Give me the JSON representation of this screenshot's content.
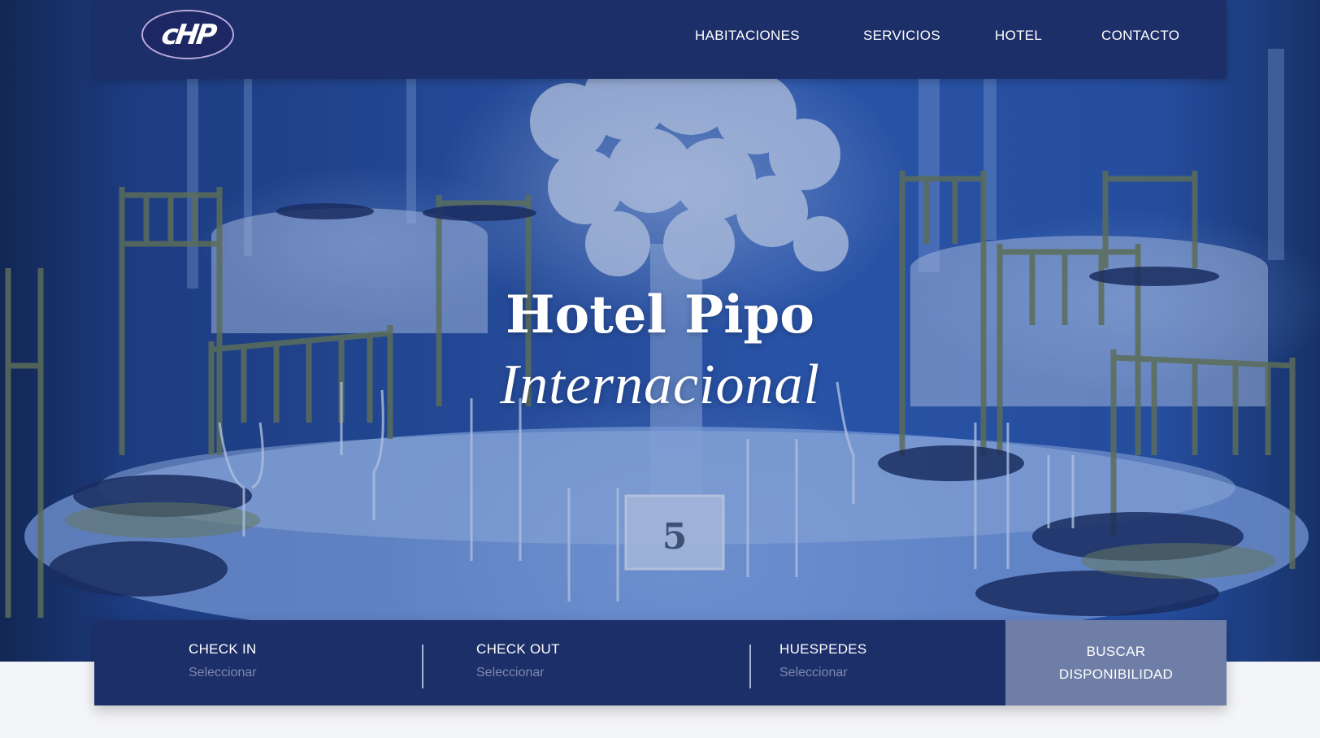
{
  "nav": {
    "logo_text": "cHP",
    "items": [
      {
        "label": "HABITACIONES"
      },
      {
        "label": "SERVICIOS"
      },
      {
        "label": "HOTEL"
      },
      {
        "label": "CONTACTO"
      }
    ]
  },
  "hero": {
    "title": "Hotel Pipo",
    "subtitle": "Internacional",
    "table_number": "5"
  },
  "booking": {
    "check_in": {
      "label": "CHECK IN",
      "value": "Seleccionar"
    },
    "check_out": {
      "label": "CHECK OUT",
      "value": "Seleccionar"
    },
    "guests": {
      "label": "HUESPEDES",
      "value": "Seleccionar"
    },
    "search_label": "BUSCAR DISPONIBILIDAD"
  },
  "colors": {
    "navy": "#1d2f69",
    "button": "#6f7ea6",
    "placeholder": "#7d88b0",
    "hero_blue": "#2f5db5"
  }
}
